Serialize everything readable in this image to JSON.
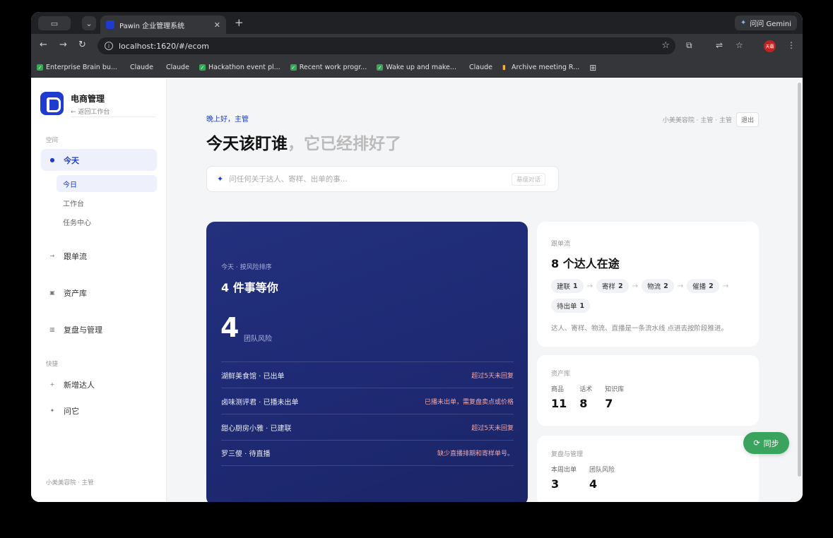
{
  "browser": {
    "tab_title": "Pawin 企业管理系统",
    "url": "localhost:1620/#/ecom",
    "gemini_label": "问问 Gemini",
    "profile_label": "天霸",
    "bookmarks": [
      {
        "label": "Enterprise Brain bu...",
        "icon": "check-icon"
      },
      {
        "label": "Claude",
        "icon": "claude-icon"
      },
      {
        "label": "Claude",
        "icon": "claude-icon"
      },
      {
        "label": "Hackathon event pl...",
        "icon": "check-icon"
      },
      {
        "label": "Recent work progr...",
        "icon": "check-icon"
      },
      {
        "label": "Wake up and make...",
        "icon": "check-icon"
      },
      {
        "label": "Claude",
        "icon": "claude-icon"
      },
      {
        "label": "Archive meeting R...",
        "icon": "folder-icon"
      }
    ]
  },
  "sidebar": {
    "brand_name": "电商管理",
    "brand_back": "← 返回工作台",
    "section_space": "空间",
    "nav_today": "今天",
    "sub_items": [
      "今日",
      "工作台",
      "任务中心"
    ],
    "nav_items": [
      "跟单流",
      "资产库",
      "复盘与管理"
    ],
    "section_quick": "快捷",
    "quick_items": [
      "新增达人",
      "问它"
    ],
    "footer": "小美美容院 · 主管"
  },
  "main": {
    "greeting": "晚上好，主管",
    "headline_main": "今天该盯谁",
    "headline_soft": "，它已经排好了",
    "user_info": "小美美容院 · 主管 · 主管",
    "logout": "退出",
    "ask_placeholder": "问任何关于达人、寄样、出单的事...",
    "ask_tag": "基座对话",
    "hero": {
      "kicker": "今天 · 按风险排序",
      "title": "4 件事等你",
      "big_number": "4",
      "big_label": "团队风险",
      "rows": [
        {
          "name": "湖鲜美食馆 · 已出单",
          "note": "超过5天未回复"
        },
        {
          "name": "卤味测评君 · 已播未出单",
          "note": "已播未出单，需复盘卖点或价格"
        },
        {
          "name": "甜心厨房小雅 · 已建联",
          "note": "超过5天未回复"
        },
        {
          "name": "罗三傻 · 待直播",
          "note": "缺少直播排期和寄样单号。"
        }
      ]
    },
    "flow_card": {
      "label": "跟单流",
      "title": "8 个达人在途",
      "stages": [
        {
          "name": "建联",
          "count": "1"
        },
        {
          "name": "寄样",
          "count": "2"
        },
        {
          "name": "物流",
          "count": "2"
        },
        {
          "name": "催播",
          "count": "2"
        },
        {
          "name": "待出单",
          "count": "1"
        }
      ],
      "desc": "达人、寄样、物流、直播是一条流水线 点进去按阶段推进。"
    },
    "asset_card": {
      "label": "资产库",
      "stats": [
        {
          "k": "商品",
          "v": "11"
        },
        {
          "k": "话术",
          "v": "8"
        },
        {
          "k": "知识库",
          "v": "7"
        }
      ]
    },
    "review_card": {
      "label": "复盘与管理",
      "stats": [
        {
          "k": "本周出单",
          "v": "3"
        },
        {
          "k": "团队风险",
          "v": "4"
        }
      ]
    },
    "sync_label": "同步"
  }
}
